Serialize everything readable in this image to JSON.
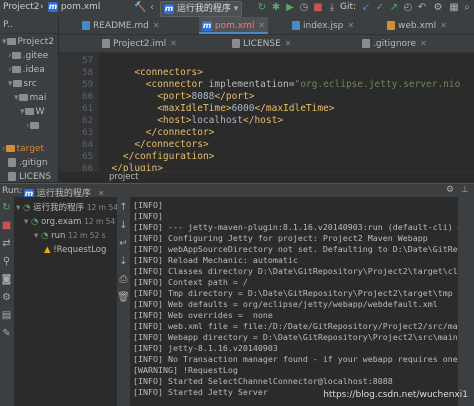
{
  "topbar": {
    "project": "Project2",
    "file_crumb": "pom.xml",
    "run_config": "运行我的程序",
    "git_label": "Git:"
  },
  "project_panel": {
    "header": "P..",
    "items": [
      {
        "label": "Project2"
      },
      {
        "label": ".gitee"
      },
      {
        "label": ".idea"
      },
      {
        "label": "src"
      },
      {
        "label": "mai"
      },
      {
        "label": "W"
      },
      {
        "label": ""
      },
      {
        "label": "target"
      },
      {
        "label": ".gitign"
      },
      {
        "label": "LICENS"
      }
    ]
  },
  "tabs_row1": [
    {
      "label": "README.md"
    },
    {
      "label": "pom.xml",
      "active": true
    },
    {
      "label": "index.jsp"
    },
    {
      "label": "web.xml"
    }
  ],
  "tabs_row2": [
    {
      "label": "Project2.iml"
    },
    {
      "label": "LICENSE"
    },
    {
      "label": ".gitignore"
    }
  ],
  "editor": {
    "line_numbers": [
      "57",
      "58",
      "59",
      "60",
      "61",
      "62",
      "63",
      "64",
      "65",
      "66"
    ],
    "breadcrumb": "project"
  },
  "run_panel": {
    "label": "Run:",
    "tab_label": "运行我的程序",
    "tree": [
      {
        "label": "运行我的程序",
        "meta": "12 m 54 s"
      },
      {
        "label": "org.exam",
        "meta": "12 m 54 s"
      },
      {
        "label": "run",
        "meta": "12 m 52 s"
      },
      {
        "label": "!RequestLog",
        "meta": ""
      }
    ],
    "console": [
      "[INFO]",
      "[INFO]",
      "[INFO] --- jetty-maven-plugin:8.1.16.v20140903:run (default-cli) @ P",
      "[INFO] Configuring Jetty for project: Project2 Maven Webapp",
      "[INFO] webAppSourceDirectory not set. Defaulting to D:\\Date\\GitRepo",
      "[INFO] Reload Mechanic: automatic",
      "[INFO] Classes directory D:\\Date\\GitRepository\\Project2\\target\\class",
      "[INFO] Context path = /",
      "[INFO] Tmp directory = D:\\Date\\GitRepository\\Project2\\target\\tmp",
      "[INFO] Web defaults = org/eclipse/jetty/webapp/webdefault.xml",
      "[INFO] Web overrides =  none",
      "[INFO] web.xml file = file:/D:/Date/GitRepository/Project2/src/main/",
      "[INFO] Webapp directory = D:\\Date\\GitRepository\\Project2\\src\\main\\we",
      "[INFO] jetty-8.1.16.v20140903",
      "[INFO] No Transaction manager found - if your webapp requires one, p",
      "[WARNING] !RequestLog",
      "[INFO] Started SelectChannelConnector@localhost:8088",
      "[INFO] Started Jetty Server"
    ]
  },
  "watermark": "https://blog.csdn.net/wuchenxi1"
}
